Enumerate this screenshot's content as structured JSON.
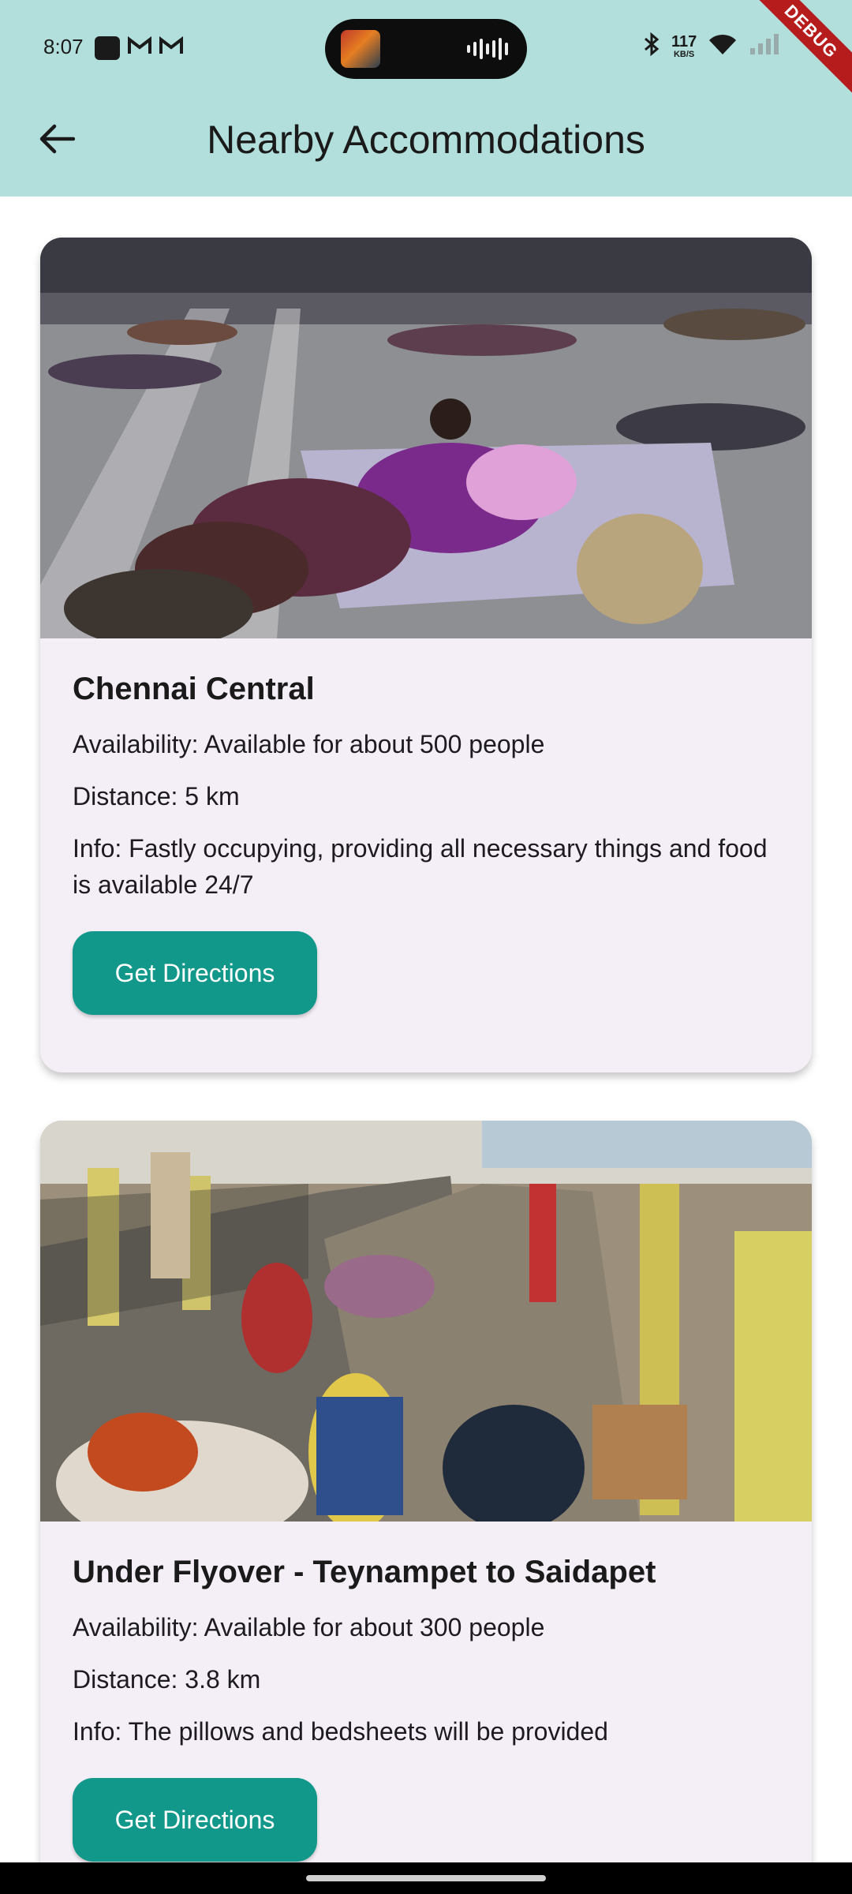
{
  "status_bar": {
    "time": "8:07",
    "left_icons": [
      "app-icon",
      "gmail-icon",
      "gmail-icon"
    ],
    "network_speed_value": "117",
    "network_speed_unit": "KB/S",
    "right_icons": [
      "bluetooth-icon",
      "wifi-icon",
      "signal-icon",
      "battery-icon"
    ]
  },
  "debug_banner": "DEBUG",
  "app_bar": {
    "back_icon": "arrow-left-icon",
    "title": "Nearby Accommodations",
    "background_color": "#b2dfdb"
  },
  "accommodations": [
    {
      "name": "Chennai Central",
      "availability": "Availability: Available for about 500 people",
      "distance": "Distance: 5 km",
      "info": "Info: Fastly occupying, providing all necessary things and food is available 24/7",
      "button_label": "Get Directions",
      "image": "photo of people resting on mats on a railway station floor"
    },
    {
      "name": "Under Flyover - Teynampet to Saidapet",
      "availability": "Availability: Available for about 300 people",
      "distance": "Distance: 3.8 km",
      "info": "Info: The pillows and bedsheets will be provided",
      "button_label": "Get Directions",
      "image": "photo of people sitting along a covered sidewalk under a flyover"
    }
  ],
  "colors": {
    "accent": "#12988a",
    "card_background": "#f4eff6"
  }
}
